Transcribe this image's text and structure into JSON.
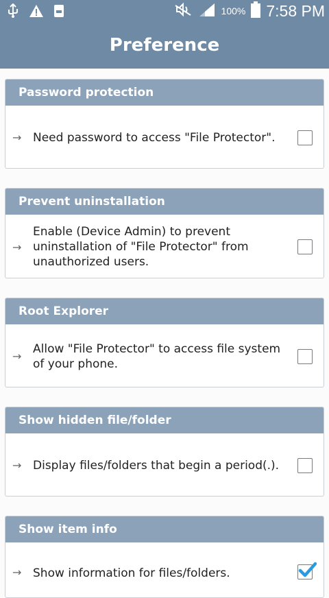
{
  "status_bar": {
    "battery_percent": "100%",
    "time": "7:58 PM"
  },
  "header": {
    "title": "Preference"
  },
  "sections": [
    {
      "title": "Password protection",
      "description": "Need password to access \"File Protector\".",
      "checked": false
    },
    {
      "title": "Prevent uninstallation",
      "description": "Enable (Device Admin) to prevent uninstallation of \"File Protector\" from unauthorized users.",
      "checked": false
    },
    {
      "title": "Root Explorer",
      "description": "Allow \"File Protector\" to access file system of your phone.",
      "checked": false
    },
    {
      "title": "Show hidden file/folder",
      "description": "Display files/folders that begin a period(.).",
      "checked": false
    },
    {
      "title": "Show item info",
      "description": "Show information for files/folders.",
      "checked": true
    }
  ],
  "icons": {
    "arrow": "right-arrow-icon",
    "check": "checkmark-icon",
    "usb": "usb-icon",
    "warning": "warning-icon",
    "storage": "storage-icon",
    "mute": "mute-icon",
    "signal": "signal-icon",
    "battery": "battery-icon"
  },
  "colors": {
    "bar": "#6f8aa5",
    "section_header": "#8ba2b9",
    "check": "#2b9ae0"
  }
}
